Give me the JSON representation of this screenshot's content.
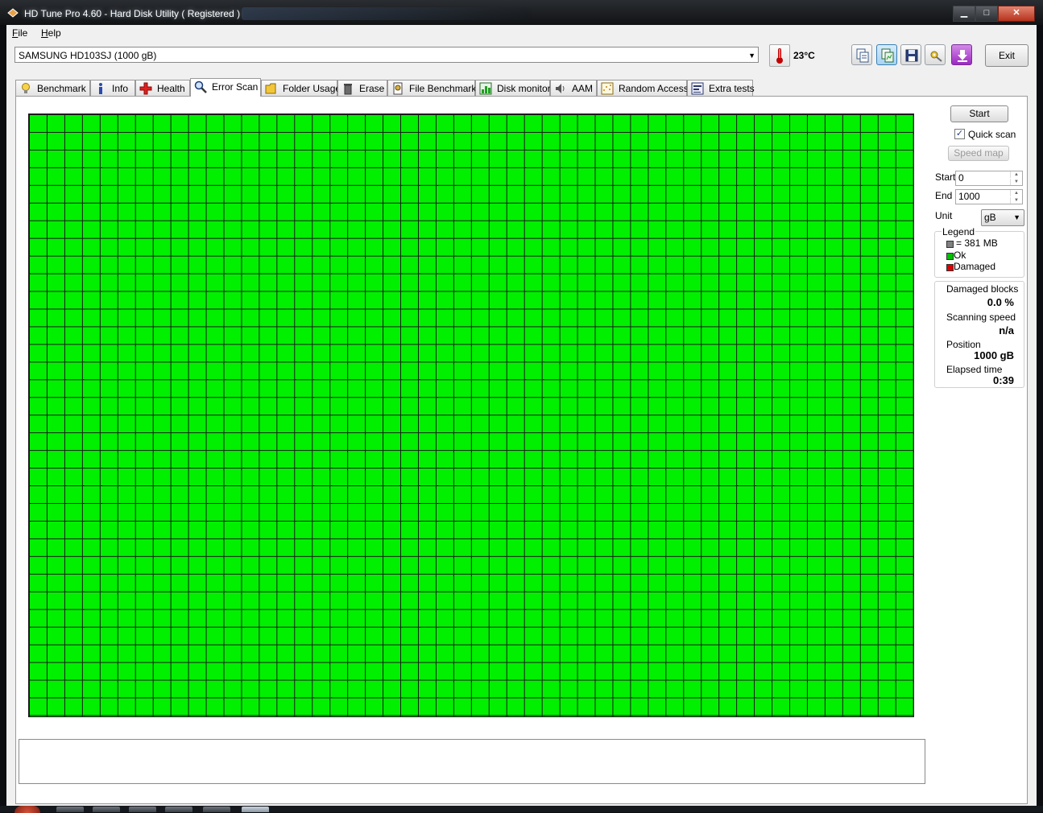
{
  "window": {
    "title": "HD Tune Pro 4.60 - Hard Disk Utility ( Registered )",
    "controls": {
      "minimize": "▁",
      "maximize": "□",
      "close": "✕"
    }
  },
  "menu": {
    "file": {
      "accel": "F",
      "rest": "ile"
    },
    "help": {
      "accel": "H",
      "rest": "elp"
    }
  },
  "toolbar": {
    "drive": "SAMSUNG HD103SJ (1000 gB)",
    "temperature": "23°C",
    "icons": [
      "copy-text-icon",
      "copy-screenshot-icon",
      "save-icon",
      "options-icon",
      "download-icon"
    ],
    "exit_label": "Exit"
  },
  "tabs": [
    {
      "label": "Benchmark",
      "icon": "lightbulb-icon"
    },
    {
      "label": "Info",
      "icon": "info-icon"
    },
    {
      "label": "Health",
      "icon": "health-cross-icon"
    },
    {
      "label": "Error Scan",
      "icon": "magnifier-icon",
      "active": true
    },
    {
      "label": "Folder Usage",
      "icon": "folder-icon"
    },
    {
      "label": "Erase",
      "icon": "trash-icon"
    },
    {
      "label": "File Benchmark",
      "icon": "file-benchmark-icon"
    },
    {
      "label": "Disk monitor",
      "icon": "disk-monitor-icon"
    },
    {
      "label": "AAM",
      "icon": "speaker-icon"
    },
    {
      "label": "Random Access",
      "icon": "random-access-icon"
    },
    {
      "label": "Extra tests",
      "icon": "extra-tests-icon"
    }
  ],
  "scan": {
    "start_button": "Start",
    "quick_scan_label": "Quick scan",
    "quick_scan_checked": true,
    "speed_map_button": "Speed map",
    "start_label": "Start",
    "start_value": "0",
    "end_label": "End",
    "end_value": "1000",
    "unit_label": "Unit",
    "unit_value": "gB",
    "block_state": "all-ok",
    "map_color_ok": "#00f000"
  },
  "legend": {
    "title": "Legend",
    "block_size": "= 381 MB",
    "ok": "Ok",
    "damaged": "Damaged",
    "colors": {
      "block": "#808080",
      "ok": "#00c000",
      "damaged": "#e00000"
    }
  },
  "stats": {
    "damaged_blocks_label": "Damaged blocks",
    "damaged_blocks_value": "0.0 %",
    "scanning_speed_label": "Scanning speed",
    "scanning_speed_value": "n/a",
    "position_label": "Position",
    "position_value": "1000 gB",
    "elapsed_time_label": "Elapsed time",
    "elapsed_time_value": "0:39"
  },
  "log": {
    "text": ""
  }
}
